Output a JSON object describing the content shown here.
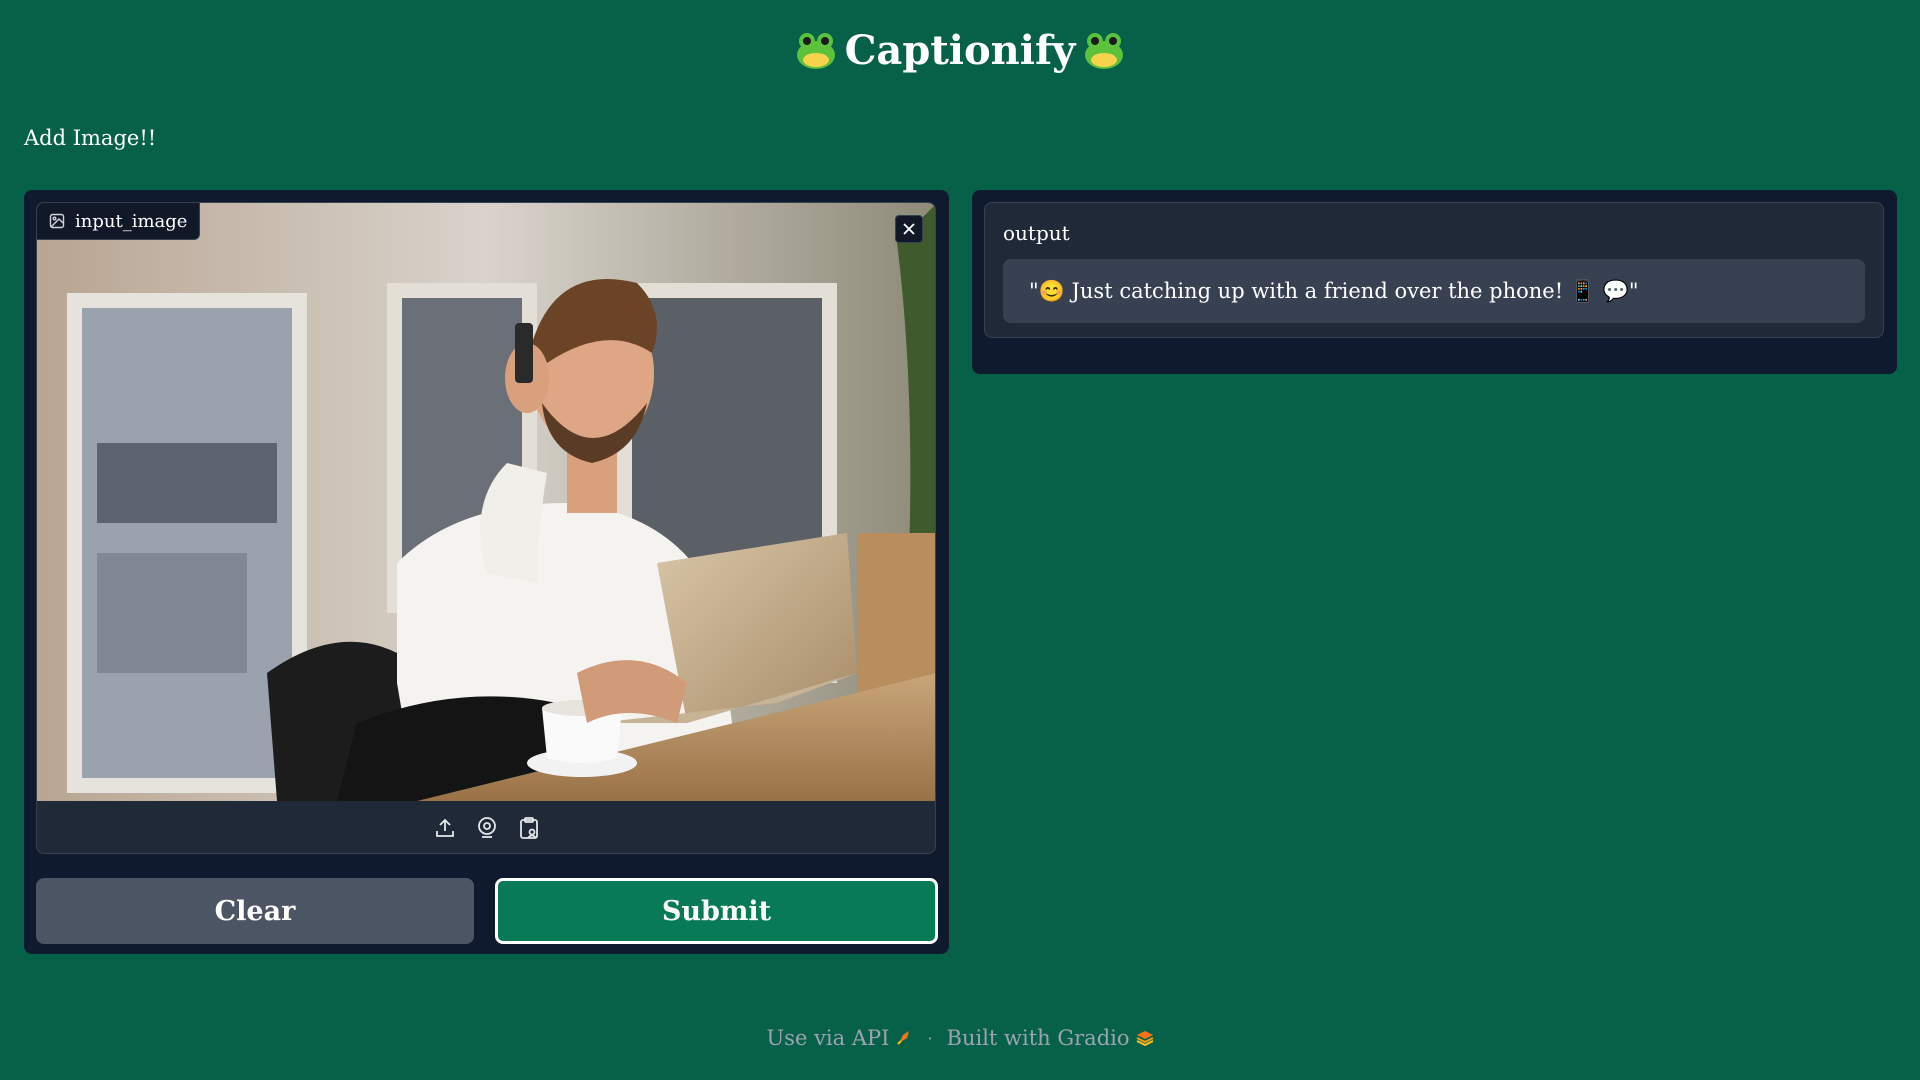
{
  "app": {
    "title": "Captionify",
    "title_icon": "frog-face-icon"
  },
  "subtitle": "Add Image!!",
  "input": {
    "label": "input_image",
    "label_icon": "image-icon",
    "close_icon": "close-icon",
    "photo_description_icon": "uploaded-photo",
    "source_icons": [
      "upload-icon",
      "webcam-icon",
      "clipboard-icon"
    ]
  },
  "buttons": {
    "clear": "Clear",
    "submit": "Submit"
  },
  "output": {
    "label": "output",
    "text": "\"😊 Just catching up with a friend over the phone! 📱 💬\""
  },
  "footer": {
    "api_link": "Use via API",
    "separator": "·",
    "built_with": "Built with Gradio"
  },
  "colors": {
    "background": "#076148",
    "panel": "#0f1a2e",
    "block": "#1f2937",
    "clear_button": "#4b5563",
    "submit_button": "#087a56"
  }
}
